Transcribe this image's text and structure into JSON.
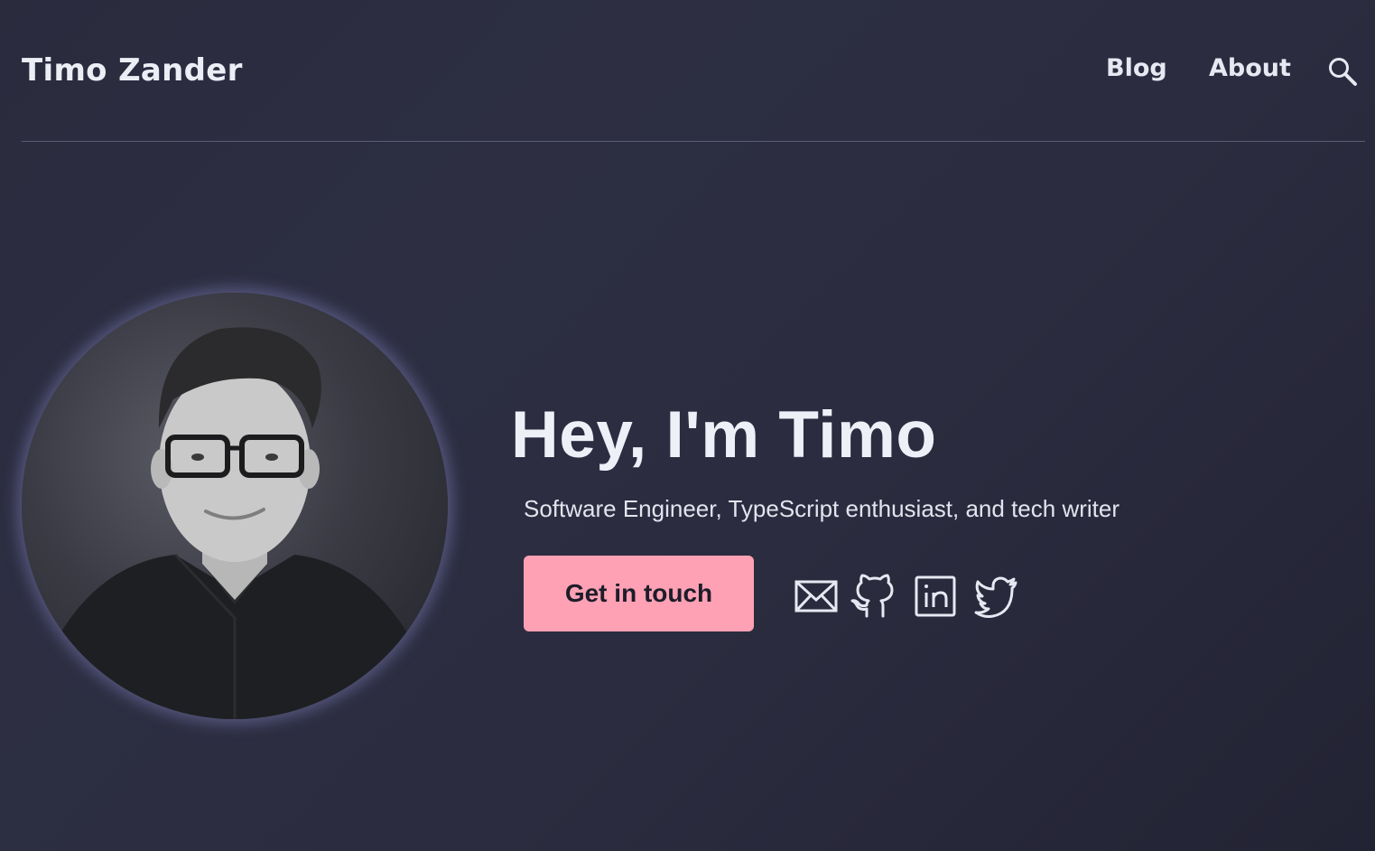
{
  "header": {
    "site_title": "Timo Zander",
    "nav": [
      {
        "label": "Blog"
      },
      {
        "label": "About"
      }
    ],
    "search_icon": "search-icon"
  },
  "hero": {
    "headline": "Hey, I'm Timo",
    "subtitle": "Software Engineer, TypeScript enthusiast, and tech writer",
    "cta_label": "Get in touch",
    "social_icons": [
      "mail-icon",
      "github-icon",
      "linkedin-icon",
      "twitter-icon"
    ]
  },
  "colors": {
    "background": "#2b2c3f",
    "accent": "#ffa1b4",
    "text": "#eceef6"
  }
}
